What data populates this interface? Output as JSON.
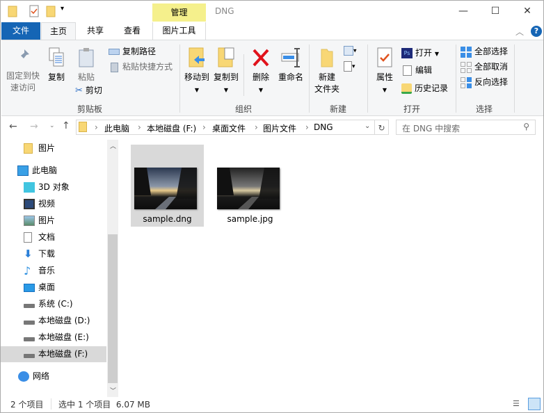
{
  "window": {
    "title": "DNG",
    "context_tab": "管理",
    "minimize": "—",
    "maximize": "☐",
    "close": "✕"
  },
  "tabs": [
    {
      "label": "文件"
    },
    {
      "label": "主页"
    },
    {
      "label": "共享"
    },
    {
      "label": "查看"
    },
    {
      "label": "图片工具"
    }
  ],
  "ribbon": {
    "clipboard": {
      "label": "剪贴板",
      "pin": "固定到快速访问",
      "pin1": "固定到快",
      "pin2": "速访问",
      "copy": "复制",
      "paste": "粘贴",
      "copy_path": "复制路径",
      "paste_shortcut": "粘贴快捷方式",
      "cut": "剪切"
    },
    "organize": {
      "label": "组织",
      "move_to": "移动到",
      "copy_to": "复制到",
      "delete": "删除",
      "rename": "重命名"
    },
    "new": {
      "label": "新建",
      "new_folder1": "新建",
      "new_folder2": "文件夹"
    },
    "open": {
      "label": "打开",
      "properties": "属性",
      "open": "打开",
      "edit": "编辑",
      "history": "历史记录"
    },
    "select": {
      "label": "选择",
      "select_all": "全部选择",
      "select_none": "全部取消",
      "invert": "反向选择"
    }
  },
  "address": {
    "crumbs": [
      "此电脑",
      "本地磁盘 (F:)",
      "桌面文件",
      "图片文件",
      "DNG"
    ],
    "search_placeholder": "在 DNG 中搜索"
  },
  "nav": [
    {
      "label": "图片"
    },
    {
      "label": "此电脑"
    },
    {
      "label": "3D 对象"
    },
    {
      "label": "视频"
    },
    {
      "label": "图片"
    },
    {
      "label": "文档"
    },
    {
      "label": "下载"
    },
    {
      "label": "音乐"
    },
    {
      "label": "桌面"
    },
    {
      "label": "系统 (C:)"
    },
    {
      "label": "本地磁盘 (D:)"
    },
    {
      "label": "本地磁盘 (E:)"
    },
    {
      "label": "本地磁盘 (F:)"
    },
    {
      "label": "网络"
    }
  ],
  "files": [
    {
      "name": "sample.dng",
      "selected": true
    },
    {
      "name": "sample.jpg",
      "selected": false
    }
  ],
  "status": {
    "count": "2 个项目",
    "selection": "选中 1 个项目  6.07 MB"
  }
}
